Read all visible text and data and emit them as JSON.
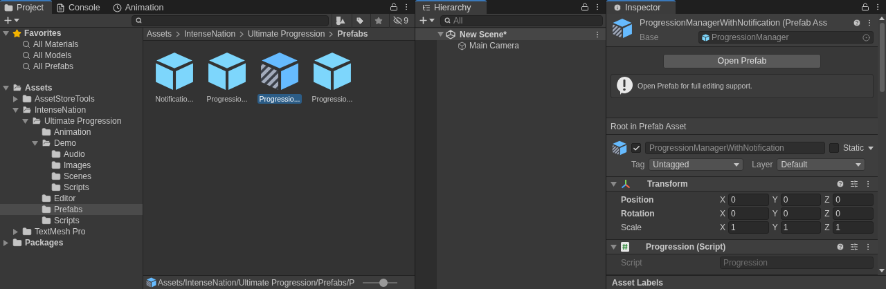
{
  "project": {
    "tabs": [
      {
        "label": "Project",
        "kind": "folder",
        "selected": true
      },
      {
        "label": "Console",
        "kind": "console",
        "selected": false
      },
      {
        "label": "Animation",
        "kind": "clock",
        "selected": false
      }
    ],
    "hidden_count": "9",
    "tree": [
      {
        "label": "Favorites",
        "kind": "favorites",
        "expanded": true,
        "selected": false,
        "children": [
          {
            "label": "All Materials",
            "kind": "search",
            "selected": false
          },
          {
            "label": "All Models",
            "kind": "search",
            "selected": false
          },
          {
            "label": "All Prefabs",
            "kind": "search",
            "selected": false
          }
        ]
      },
      {
        "label": "Assets",
        "kind": "root",
        "expanded": true,
        "selected": false,
        "children": [
          {
            "label": "AssetStoreTools",
            "kind": "folder",
            "expanded": false,
            "selected": false
          },
          {
            "label": "IntenseNation",
            "kind": "folder",
            "expanded": true,
            "selected": false,
            "children": [
              {
                "label": "Ultimate Progression",
                "kind": "folder",
                "expanded": true,
                "selected": false,
                "children": [
                  {
                    "label": "Animation",
                    "kind": "folder",
                    "selected": false
                  },
                  {
                    "label": "Demo",
                    "kind": "folder",
                    "expanded": true,
                    "selected": false,
                    "children": [
                      {
                        "label": "Audio",
                        "kind": "folder",
                        "selected": false
                      },
                      {
                        "label": "Images",
                        "kind": "folder",
                        "selected": false
                      },
                      {
                        "label": "Scenes",
                        "kind": "folder",
                        "selected": false
                      },
                      {
                        "label": "Scripts",
                        "kind": "folder",
                        "selected": false
                      }
                    ]
                  },
                  {
                    "label": "Editor",
                    "kind": "folder",
                    "selected": false
                  },
                  {
                    "label": "Prefabs",
                    "kind": "folder",
                    "selected": true
                  },
                  {
                    "label": "Scripts",
                    "kind": "folder",
                    "selected": false
                  }
                ]
              }
            ]
          },
          {
            "label": "TextMesh Pro",
            "kind": "folder",
            "expanded": false,
            "selected": false
          }
        ]
      },
      {
        "label": "Packages",
        "kind": "root",
        "expanded": false,
        "selected": false
      }
    ],
    "breadcrumb": [
      "Assets",
      "IntenseNation",
      "Ultimate Progression",
      "Prefabs"
    ],
    "assets": [
      {
        "label": "Notificatio...",
        "kind": "prefab",
        "selected": false
      },
      {
        "label": "Progressio...",
        "kind": "prefab",
        "selected": false
      },
      {
        "label": "Progressio...",
        "kind": "variant",
        "selected": true
      },
      {
        "label": "Progressio...",
        "kind": "prefab",
        "selected": false
      }
    ],
    "path": "Assets/IntenseNation/Ultimate Progression/Prefabs/P",
    "zoom": {
      "level": 0.6
    }
  },
  "hierarchy": {
    "tabs": [
      {
        "label": "Hierarchy",
        "selected": true
      }
    ],
    "search": {
      "placeholder": "All"
    },
    "scene": {
      "name": "New Scene*",
      "expanded": true,
      "children": [
        {
          "name": "Main Camera"
        }
      ]
    }
  },
  "inspector": {
    "tabs": [
      {
        "label": "Inspector",
        "selected": true
      }
    ],
    "title": "ProgressionManagerWithNotification (Prefab Ass",
    "base_label": "Base",
    "base_value": "ProgressionManager",
    "open_button": "Open Prefab",
    "help": "Open Prefab for full editing support.",
    "section": "Root in Prefab Asset",
    "object": {
      "active": true,
      "name": "ProgressionManagerWithNotification",
      "static": false,
      "static_label": "Static",
      "tag_label": "Tag",
      "tag": "Untagged",
      "layer_label": "Layer",
      "layer": "Default"
    },
    "components": [
      {
        "kind": "transform",
        "title": "Transform",
        "expanded": true,
        "rows": [
          {
            "label": "Position",
            "overridden": true,
            "fields": [
              {
                "axis": "X",
                "value": "0"
              },
              {
                "axis": "Y",
                "value": "0"
              },
              {
                "axis": "Z",
                "value": "0"
              }
            ]
          },
          {
            "label": "Rotation",
            "overridden": true,
            "fields": [
              {
                "axis": "X",
                "value": "0"
              },
              {
                "axis": "Y",
                "value": "0"
              },
              {
                "axis": "Z",
                "value": "0"
              }
            ]
          },
          {
            "label": "Scale",
            "overridden": false,
            "fields": [
              {
                "axis": "X",
                "value": "1"
              },
              {
                "axis": "Y",
                "value": "1"
              },
              {
                "axis": "Z",
                "value": "1"
              }
            ]
          }
        ]
      },
      {
        "kind": "script",
        "title": "Progression (Script)",
        "expanded": true,
        "rows": [
          {
            "label": "Script",
            "value": "Progression",
            "disabled": true
          }
        ]
      }
    ],
    "footer": "Asset Labels"
  }
}
